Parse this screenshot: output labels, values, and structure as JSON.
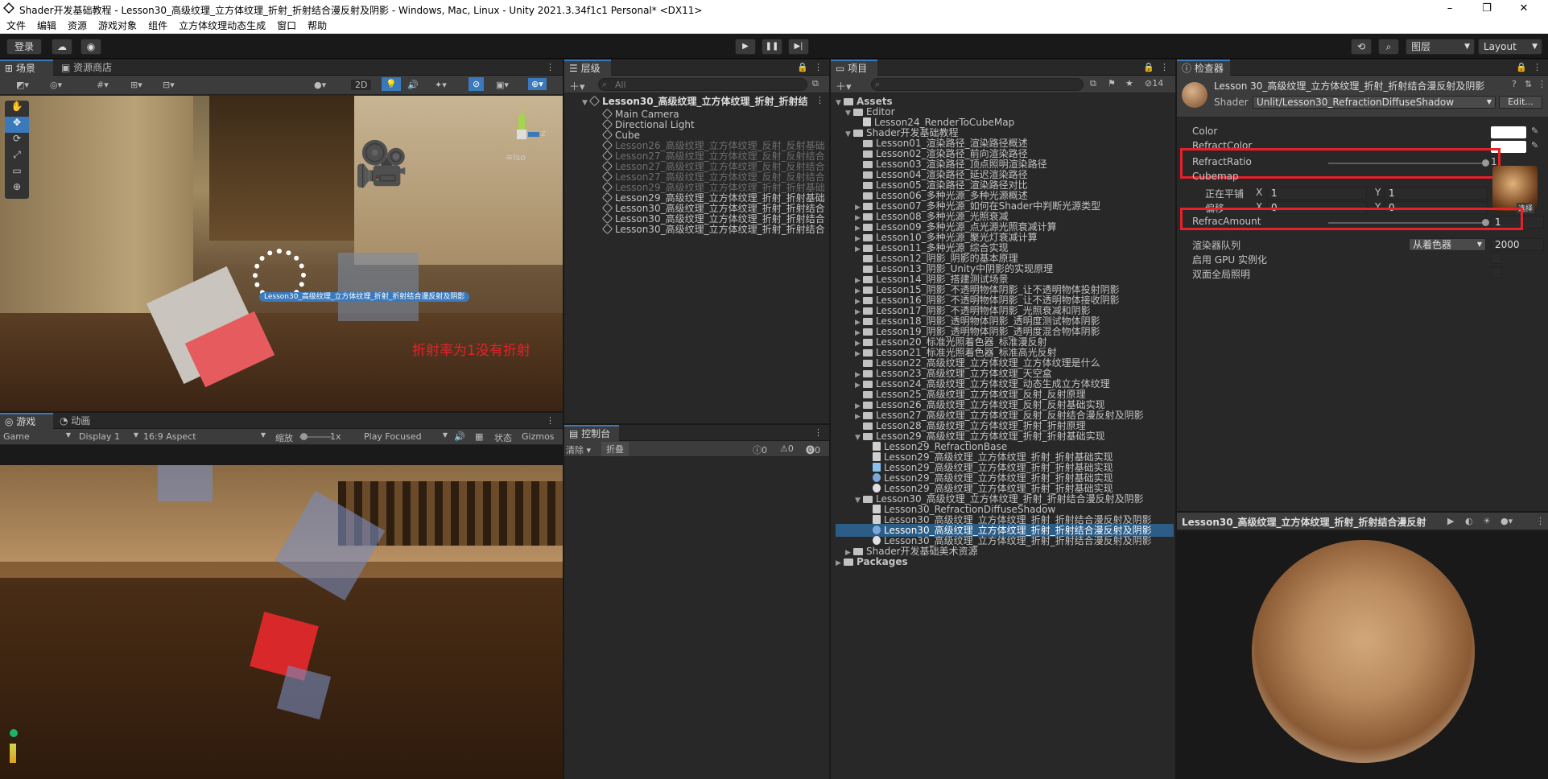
{
  "window": {
    "title": "Shader开发基础教程 - Lesson30_高级纹理_立方体纹理_折射_折射结合漫反射及阴影 - Windows, Mac, Linux - Unity 2021.3.34f1c1 Personal* <DX11>",
    "minimize": "–",
    "maximize": "❐",
    "close": "✕"
  },
  "menu": [
    "文件",
    "编辑",
    "资源",
    "游戏对象",
    "组件",
    "立方体纹理动态生成",
    "窗口",
    "帮助"
  ],
  "toolbar": {
    "login": "登录",
    "layers": "图层",
    "layout": "Layout"
  },
  "scene": {
    "tab_scene": "场景",
    "tab_store": "资源商店",
    "btn_2d": "2D",
    "iso": "≡Iso",
    "gizmo_y": "y",
    "gizmo_z": "z",
    "object_label": "Lesson30_高级纹理_立方体纹理_折射_折射结合漫反射及阴影",
    "annotation": "折射率为1没有折射"
  },
  "game": {
    "tab_game": "游戏",
    "tab_anim": "动画",
    "mode": "Game",
    "display": "Display 1",
    "aspect": "16:9 Aspect",
    "scale_label": "缩放",
    "scale_value": "1x",
    "play_mode": "Play Focused",
    "stats": "状态",
    "gizmos": "Gizmos"
  },
  "hierarchy": {
    "tab": "层级",
    "search_placeholder": "All",
    "root": "Lesson30_高级纹理_立方体纹理_折射_折射结",
    "items": [
      {
        "label": "Main Camera",
        "dim": false
      },
      {
        "label": "Directional Light",
        "dim": false
      },
      {
        "label": "Cube",
        "dim": false
      },
      {
        "label": "Lesson26_高级纹理_立方体纹理_反射_反射基础",
        "dim": true
      },
      {
        "label": "Lesson27_高级纹理_立方体纹理_反射_反射结合",
        "dim": true
      },
      {
        "label": "Lesson27_高级纹理_立方体纹理_反射_反射结合",
        "dim": true
      },
      {
        "label": "Lesson27_高级纹理_立方体纹理_反射_反射结合",
        "dim": true
      },
      {
        "label": "Lesson29_高级纹理_立方体纹理_折射_折射基础",
        "dim": true
      },
      {
        "label": "Lesson29_高级纹理_立方体纹理_折射_折射基础",
        "dim": false
      },
      {
        "label": "Lesson30_高级纹理_立方体纹理_折射_折射结合",
        "dim": false
      },
      {
        "label": "Lesson30_高级纹理_立方体纹理_折射_折射结合",
        "dim": false
      },
      {
        "label": "Lesson30_高级纹理_立方体纹理_折射_折射结合",
        "dim": false
      }
    ]
  },
  "console": {
    "tab": "控制台",
    "clear": "清除",
    "collapse": "折叠",
    "count_info": "0",
    "count_warn": "0",
    "count_error": "0"
  },
  "project": {
    "tab": "项目",
    "hidden_count": "14",
    "items": [
      {
        "label": "Assets",
        "indent": 0,
        "type": "folder",
        "arrow": "▼",
        "bold": true
      },
      {
        "label": "Editor",
        "indent": 1,
        "type": "folder",
        "arrow": "▼"
      },
      {
        "label": "Lesson24_RenderToCubeMap",
        "indent": 2,
        "type": "file",
        "arrow": ""
      },
      {
        "label": "Shader开发基础教程",
        "indent": 1,
        "type": "folder",
        "arrow": "▼"
      },
      {
        "label": "Lesson01_渲染路径_渲染路径概述",
        "indent": 2,
        "type": "folder",
        "arrow": ""
      },
      {
        "label": "Lesson02_渲染路径_前向渲染路径",
        "indent": 2,
        "type": "folder",
        "arrow": ""
      },
      {
        "label": "Lesson03_渲染路径_顶点照明渲染路径",
        "indent": 2,
        "type": "folder",
        "arrow": ""
      },
      {
        "label": "Lesson04_渲染路径_延迟渲染路径",
        "indent": 2,
        "type": "folder",
        "arrow": ""
      },
      {
        "label": "Lesson05_渲染路径_渲染路径对比",
        "indent": 2,
        "type": "folder",
        "arrow": ""
      },
      {
        "label": "Lesson06_多种光源_多种光源概述",
        "indent": 2,
        "type": "folder",
        "arrow": ""
      },
      {
        "label": "Lesson07_多种光源_如何在Shader中判断光源类型",
        "indent": 2,
        "type": "folder",
        "arrow": "▶"
      },
      {
        "label": "Lesson08_多种光源_光照衰减",
        "indent": 2,
        "type": "folder",
        "arrow": "▶"
      },
      {
        "label": "Lesson09_多种光源_点光源光照衰减计算",
        "indent": 2,
        "type": "folder",
        "arrow": "▶"
      },
      {
        "label": "Lesson10_多种光源_聚光灯衰减计算",
        "indent": 2,
        "type": "folder",
        "arrow": "▶"
      },
      {
        "label": "Lesson11_多种光源_综合实现",
        "indent": 2,
        "type": "folder",
        "arrow": "▶"
      },
      {
        "label": "Lesson12_阴影_阴影的基本原理",
        "indent": 2,
        "type": "folder",
        "arrow": ""
      },
      {
        "label": "Lesson13_阴影_Unity中阴影的实现原理",
        "indent": 2,
        "type": "folder",
        "arrow": ""
      },
      {
        "label": "Lesson14_阴影_搭建测试场景",
        "indent": 2,
        "type": "folder",
        "arrow": "▶"
      },
      {
        "label": "Lesson15_阴影_不透明物体阴影_让不透明物体投射阴影",
        "indent": 2,
        "type": "folder",
        "arrow": "▶"
      },
      {
        "label": "Lesson16_阴影_不透明物体阴影_让不透明物体接收阴影",
        "indent": 2,
        "type": "folder",
        "arrow": "▶"
      },
      {
        "label": "Lesson17_阴影_不透明物体阴影_光照衰减和阴影",
        "indent": 2,
        "type": "folder",
        "arrow": "▶"
      },
      {
        "label": "Lesson18_阴影_透明物体阴影_透明度测试物体阴影",
        "indent": 2,
        "type": "folder",
        "arrow": "▶"
      },
      {
        "label": "Lesson19_阴影_透明物体阴影_透明度混合物体阴影",
        "indent": 2,
        "type": "folder",
        "arrow": "▶"
      },
      {
        "label": "Lesson20_标准光照着色器_标准漫反射",
        "indent": 2,
        "type": "folder",
        "arrow": "▶"
      },
      {
        "label": "Lesson21_标准光照着色器_标准高光反射",
        "indent": 2,
        "type": "folder",
        "arrow": "▶"
      },
      {
        "label": "Lesson22_高级纹理_立方体纹理_立方体纹理是什么",
        "indent": 2,
        "type": "folder",
        "arrow": ""
      },
      {
        "label": "Lesson23_高级纹理_立方体纹理_天空盒",
        "indent": 2,
        "type": "folder",
        "arrow": "▶"
      },
      {
        "label": "Lesson24_高级纹理_立方体纹理_动态生成立方体纹理",
        "indent": 2,
        "type": "folder",
        "arrow": "▶"
      },
      {
        "label": "Lesson25_高级纹理_立方体纹理_反射_反射原理",
        "indent": 2,
        "type": "folder",
        "arrow": ""
      },
      {
        "label": "Lesson26_高级纹理_立方体纹理_反射_反射基础实现",
        "indent": 2,
        "type": "folder",
        "arrow": "▶"
      },
      {
        "label": "Lesson27_高级纹理_立方体纹理_反射_反射结合漫反射及阴影",
        "indent": 2,
        "type": "folder",
        "arrow": "▶"
      },
      {
        "label": "Lesson28_高级纹理_立方体纹理_折射_折射原理",
        "indent": 2,
        "type": "folder",
        "arrow": ""
      },
      {
        "label": "Lesson29_高级纹理_立方体纹理_折射_折射基础实现",
        "indent": 2,
        "type": "folder",
        "arrow": "▼"
      },
      {
        "label": "Lesson29_RefractionBase",
        "indent": 3,
        "type": "script",
        "arrow": ""
      },
      {
        "label": "Lesson29_高级纹理_立方体纹理_折射_折射基础实现",
        "indent": 3,
        "type": "mat",
        "arrow": ""
      },
      {
        "label": "Lesson29_高级纹理_立方体纹理_折射_折射基础实现",
        "indent": 3,
        "type": "shader",
        "arrow": ""
      },
      {
        "label": "Lesson29_高级纹理_立方体纹理_折射_折射基础实现",
        "indent": 3,
        "type": "sphere",
        "arrow": ""
      },
      {
        "label": "Lesson29_高级纹理_立方体纹理_折射_折射基础实现",
        "indent": 3,
        "type": "scene",
        "arrow": ""
      },
      {
        "label": "Lesson30_高级纹理_立方体纹理_折射_折射结合漫反射及阴影",
        "indent": 2,
        "type": "folder",
        "arrow": "▼"
      },
      {
        "label": "Lesson30_RefractionDiffuseShadow",
        "indent": 3,
        "type": "script",
        "arrow": ""
      },
      {
        "label": "Lesson30_高级纹理_立方体纹理_折射_折射结合漫反射及阴影",
        "indent": 3,
        "type": "file",
        "arrow": ""
      },
      {
        "label": "Lesson30_高级纹理_立方体纹理_折射_折射结合漫反射及阴影",
        "indent": 3,
        "type": "sphere",
        "arrow": "",
        "selected": true
      },
      {
        "label": "Lesson30_高级纹理_立方体纹理_折射_折射结合漫反射及阴影",
        "indent": 3,
        "type": "scene",
        "arrow": ""
      },
      {
        "label": "Shader开发基础美术资源",
        "indent": 1,
        "type": "folder",
        "arrow": "▶"
      },
      {
        "label": "Packages",
        "indent": 0,
        "type": "folder",
        "arrow": "▶",
        "bold": true
      }
    ]
  },
  "inspector": {
    "tab": "检查器",
    "material_name": "Lesson 30_高级纹理_立方体纹理_折射_折射结合漫反射及阴影",
    "shader_label": "Shader",
    "shader_value": "Unlit/Lesson30_RefractionDiffuseShadow",
    "edit": "Edit...",
    "color": "Color",
    "refract_color": "RefractColor",
    "refract_ratio": "RefractRatio",
    "refract_ratio_value": "1",
    "refract_ratio_fraction": 1.0,
    "cubemap": "Cubemap",
    "tiling": "正在平铺",
    "offset": "偏移",
    "x": "X",
    "y": "Y",
    "tiling_x": "1",
    "tiling_y": "1",
    "offset_x": "0",
    "offset_y": "0",
    "select": "选择",
    "refrac_amount": "RefracAmount",
    "refrac_amount_value": "1",
    "refrac_amount_fraction": 1.0,
    "render_queue": "渲染器队列",
    "render_queue_mode": "从着色器",
    "render_queue_value": "2000",
    "gpu_instancing": "启用 GPU 实例化",
    "double_sided_gi": "双面全局照明",
    "preview_title": "Lesson30_高级纹理_立方体纹理_折射_折射结合漫反射",
    "colors": {
      "highlight": "#e8202a",
      "selection": "#2c5d87",
      "accent": "#3a79bb"
    }
  }
}
